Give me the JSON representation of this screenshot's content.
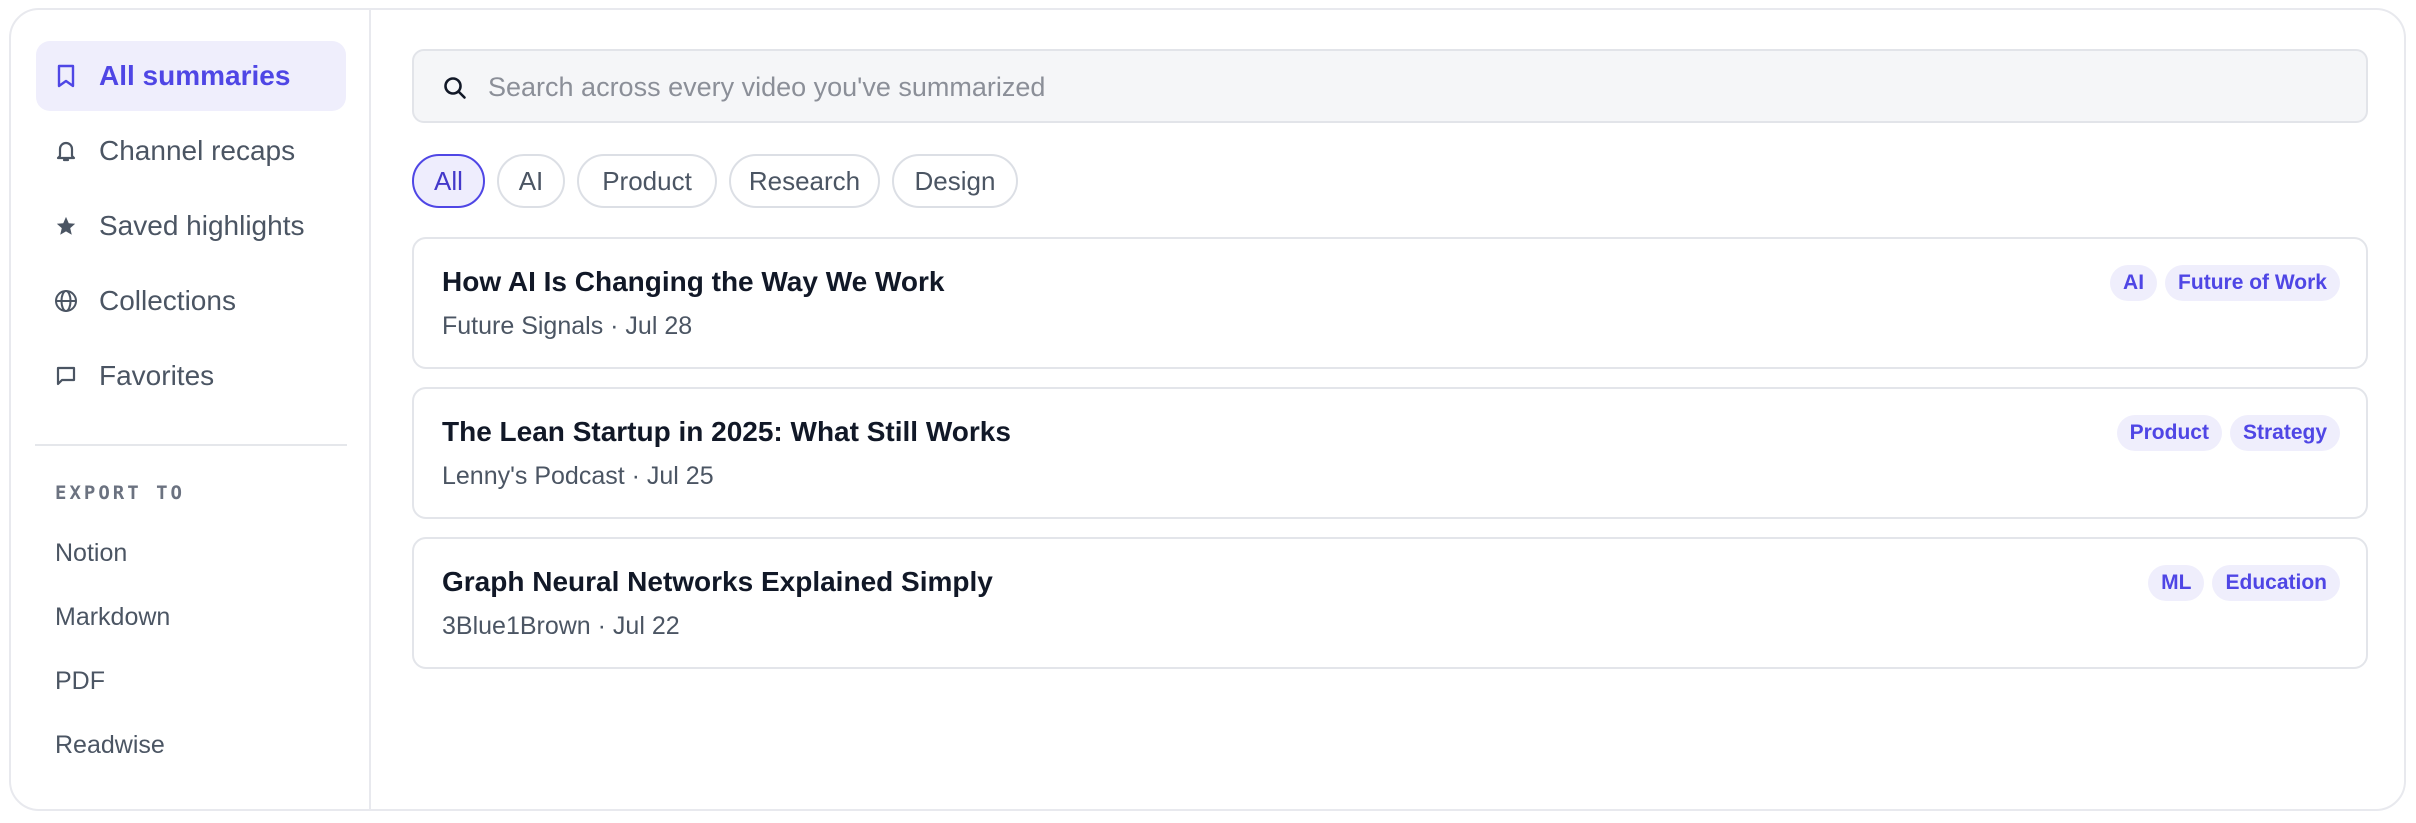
{
  "sidebar": {
    "items": [
      {
        "label": "All summaries",
        "icon": "bookmark-icon",
        "active": true
      },
      {
        "label": "Channel recaps",
        "icon": "bell-icon",
        "active": false
      },
      {
        "label": "Saved highlights",
        "icon": "star-icon",
        "active": false
      },
      {
        "label": "Collections",
        "icon": "globe-icon",
        "active": false
      },
      {
        "label": "Favorites",
        "icon": "message-icon",
        "active": false
      }
    ],
    "export_heading": "EXPORT TO",
    "export_items": [
      "Notion",
      "Markdown",
      "PDF",
      "Readwise"
    ]
  },
  "search": {
    "placeholder": "Search across every video you've summarized",
    "value": ""
  },
  "filters": [
    {
      "label": "All",
      "active": true
    },
    {
      "label": "AI",
      "active": false
    },
    {
      "label": "Product",
      "active": false
    },
    {
      "label": "Research",
      "active": false
    },
    {
      "label": "Design",
      "active": false
    }
  ],
  "videos": [
    {
      "title": "How AI Is Changing the Way We Work",
      "meta": "Future Signals · Jul 28",
      "tags": [
        "AI",
        "Future of Work"
      ]
    },
    {
      "title": "The Lean Startup in 2025: What Still Works",
      "meta": "Lenny's Podcast · Jul 25",
      "tags": [
        "Product",
        "Strategy"
      ]
    },
    {
      "title": "Graph Neural Networks Explained Simply",
      "meta": "3Blue1Brown · Jul 22",
      "tags": [
        "ML",
        "Education"
      ]
    }
  ],
  "colors": {
    "accent": "#4f46e5",
    "accent_bg": "#efeefc",
    "border": "#e3e5ea"
  }
}
